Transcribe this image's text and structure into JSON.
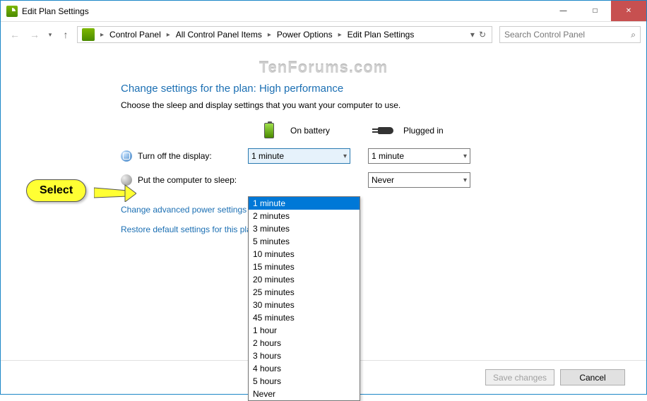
{
  "window": {
    "title": "Edit Plan Settings"
  },
  "breadcrumb": {
    "items": [
      "Control Panel",
      "All Control Panel Items",
      "Power Options",
      "Edit Plan Settings"
    ]
  },
  "search": {
    "placeholder": "Search Control Panel"
  },
  "watermark": "TenForums.com",
  "page": {
    "heading": "Change settings for the plan: High performance",
    "description": "Choose the sleep and display settings that you want your computer to use.",
    "col_battery": "On battery",
    "col_plugged": "Plugged in",
    "row_display": "Turn off the display:",
    "row_sleep": "Put the computer to sleep:",
    "values": {
      "display_battery": "1 minute",
      "display_plugged": "1 minute",
      "sleep_battery": "",
      "sleep_plugged": "Never"
    },
    "link_advanced": "Change advanced power settings",
    "link_restore": "Restore default settings for this plan"
  },
  "dropdown": {
    "options": [
      "1 minute",
      "2 minutes",
      "3 minutes",
      "5 minutes",
      "10 minutes",
      "15 minutes",
      "20 minutes",
      "25 minutes",
      "30 minutes",
      "45 minutes",
      "1 hour",
      "2 hours",
      "3 hours",
      "4 hours",
      "5 hours",
      "Never"
    ],
    "selected_index": 0
  },
  "footer": {
    "save": "Save changes",
    "cancel": "Cancel"
  },
  "callout": {
    "text": "Select"
  }
}
